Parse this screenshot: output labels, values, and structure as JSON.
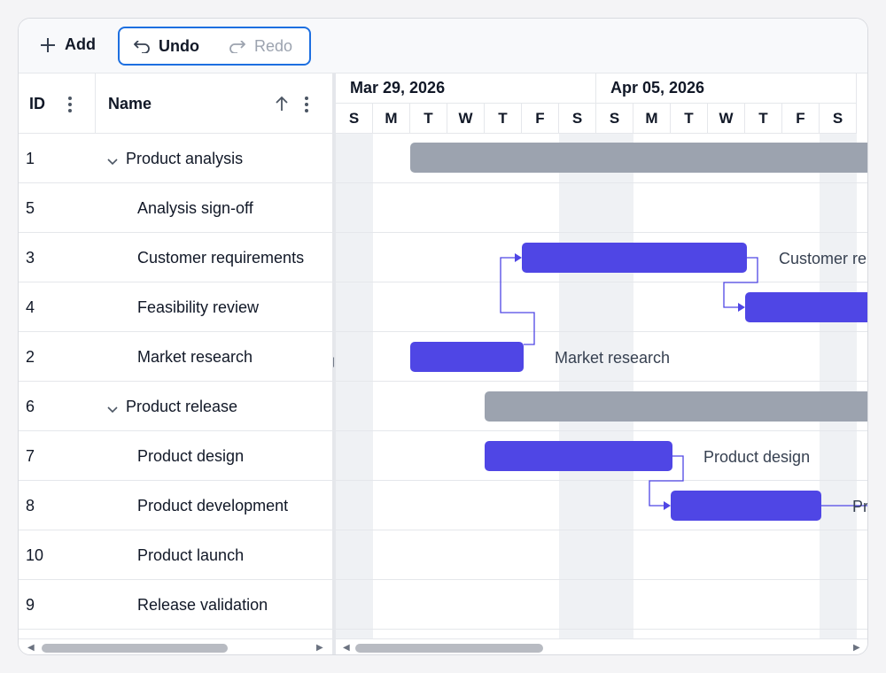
{
  "toolbar": {
    "add_label": "Add",
    "undo_label": "Undo",
    "redo_label": "Redo"
  },
  "grid": {
    "columns": {
      "id": "ID",
      "name": "Name"
    },
    "rows": [
      {
        "id": "1",
        "name": "Product analysis"
      },
      {
        "id": "5",
        "name": "Analysis sign-off"
      },
      {
        "id": "3",
        "name": "Customer requirements"
      },
      {
        "id": "4",
        "name": "Feasibility review"
      },
      {
        "id": "2",
        "name": "Market research"
      },
      {
        "id": "6",
        "name": "Product release"
      },
      {
        "id": "7",
        "name": "Product design"
      },
      {
        "id": "8",
        "name": "Product development"
      },
      {
        "id": "10",
        "name": "Product launch"
      },
      {
        "id": "9",
        "name": "Release validation"
      }
    ]
  },
  "timeline": {
    "weeks": [
      "Mar 29, 2026",
      "Apr 05, 2026"
    ],
    "days": [
      "S",
      "M",
      "T",
      "W",
      "T",
      "F",
      "S",
      "S",
      "M",
      "T",
      "W",
      "T",
      "F",
      "S"
    ]
  },
  "bar_labels": {
    "customer_requirements": "Customer re",
    "market_research": "Market research",
    "product_design": "Product design",
    "product_development": "Pr"
  },
  "colors": {
    "task_bar": "#4f46e5",
    "summary_bar": "#9ca3af",
    "focus_border": "#1d6fe0",
    "weekend": "#eff1f4"
  }
}
